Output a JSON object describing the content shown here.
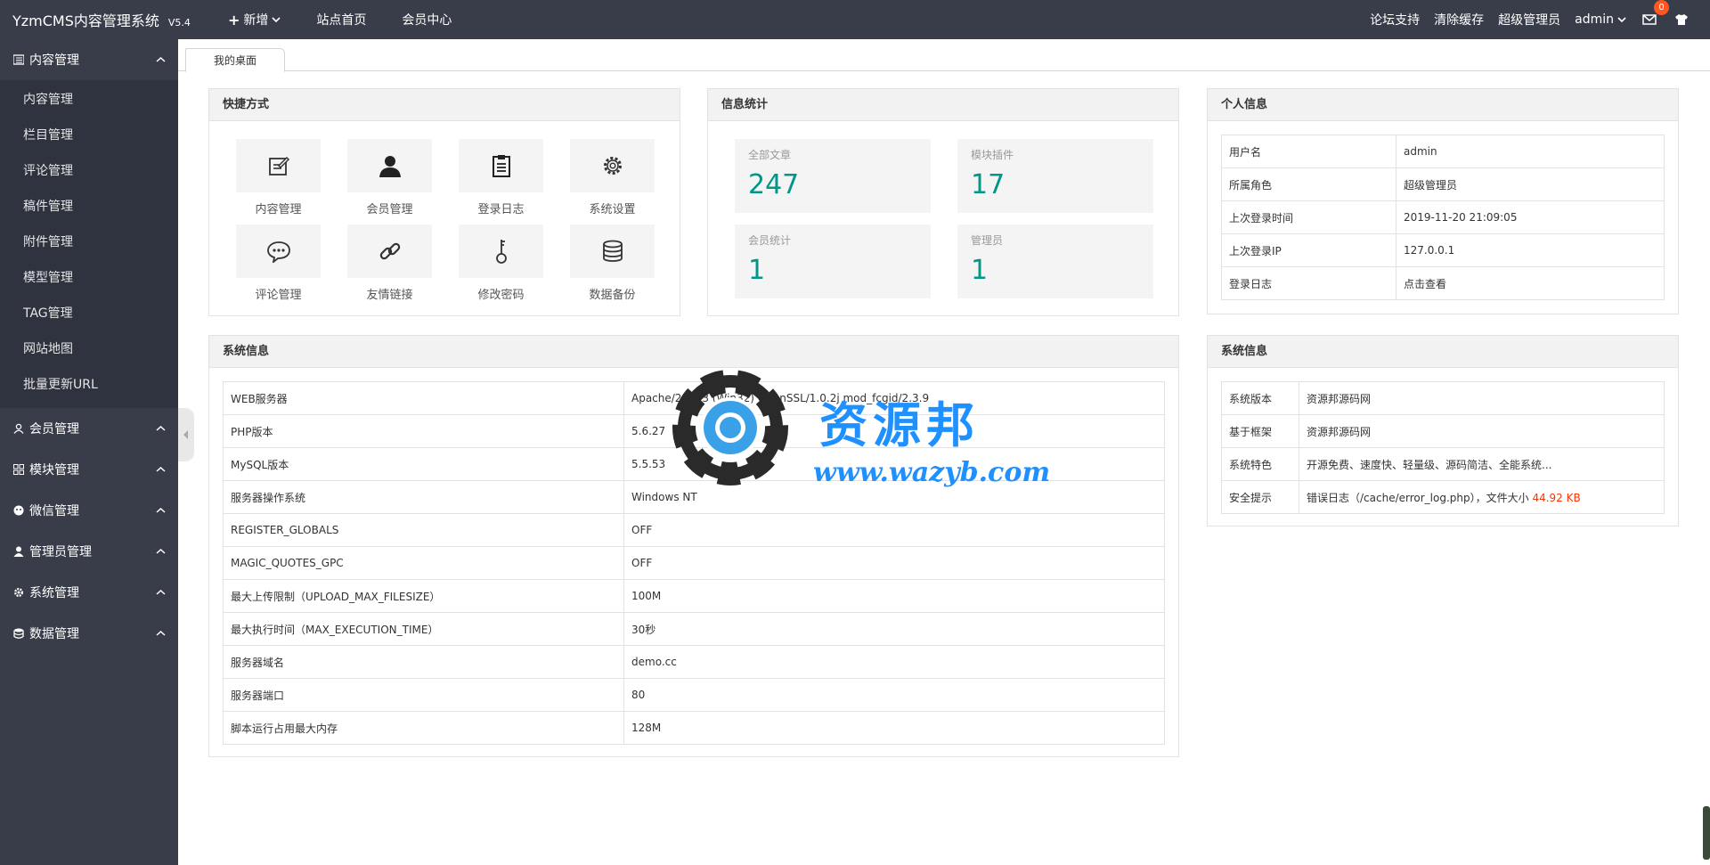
{
  "topbar": {
    "brand": "YzmCMS内容管理系统",
    "version": "V5.4",
    "nav": [
      "新增",
      "站点首页",
      "会员中心"
    ],
    "right": {
      "forum": "论坛支持",
      "clear_cache": "清除缓存",
      "role": "超级管理员",
      "user": "admin",
      "mail_count": "0"
    }
  },
  "sidebar": {
    "groups": [
      {
        "label": "内容管理",
        "icon": "list-icon",
        "expanded": true,
        "items": [
          "内容管理",
          "栏目管理",
          "评论管理",
          "稿件管理",
          "附件管理",
          "模型管理",
          "TAG管理",
          "网站地图",
          "批量更新URL"
        ]
      },
      {
        "label": "会员管理",
        "icon": "user-icon"
      },
      {
        "label": "模块管理",
        "icon": "grid-icon"
      },
      {
        "label": "微信管理",
        "icon": "wechat-icon"
      },
      {
        "label": "管理员管理",
        "icon": "admin-icon"
      },
      {
        "label": "系统管理",
        "icon": "gear-icon"
      },
      {
        "label": "数据管理",
        "icon": "database-icon"
      }
    ]
  },
  "tabs": {
    "active": "我的桌面"
  },
  "shortcuts": {
    "title": "快捷方式",
    "items": [
      {
        "label": "内容管理",
        "icon": "edit-icon"
      },
      {
        "label": "会员管理",
        "icon": "user-icon"
      },
      {
        "label": "登录日志",
        "icon": "clipboard-icon"
      },
      {
        "label": "系统设置",
        "icon": "gear-icon"
      },
      {
        "label": "评论管理",
        "icon": "comment-icon"
      },
      {
        "label": "友情链接",
        "icon": "link-icon"
      },
      {
        "label": "修改密码",
        "icon": "key-icon"
      },
      {
        "label": "数据备份",
        "icon": "database-icon"
      }
    ]
  },
  "stats": {
    "title": "信息统计",
    "items": [
      {
        "label": "全部文章",
        "value": "247"
      },
      {
        "label": "模块插件",
        "value": "17"
      },
      {
        "label": "会员统计",
        "value": "1"
      },
      {
        "label": "管理员",
        "value": "1"
      }
    ]
  },
  "profile": {
    "title": "个人信息",
    "rows": [
      {
        "k": "用户名",
        "v": "admin"
      },
      {
        "k": "所属角色",
        "v": "超级管理员"
      },
      {
        "k": "上次登录时间",
        "v": "2019-11-20 21:09:05"
      },
      {
        "k": "上次登录IP",
        "v": "127.0.0.1"
      },
      {
        "k": "登录日志",
        "v": "点击查看"
      }
    ]
  },
  "sysinfo": {
    "title": "系统信息",
    "rows": [
      {
        "k": "WEB服务器",
        "v": "Apache/2.4.23 (Win32) OpenSSL/1.0.2j mod_fcgid/2.3.9"
      },
      {
        "k": "PHP版本",
        "v": "5.6.27"
      },
      {
        "k": "MySQL版本",
        "v": "5.5.53"
      },
      {
        "k": "服务器操作系统",
        "v": "Windows NT"
      },
      {
        "k": "REGISTER_GLOBALS",
        "v": "OFF"
      },
      {
        "k": "MAGIC_QUOTES_GPC",
        "v": "OFF"
      },
      {
        "k": "最大上传限制（UPLOAD_MAX_FILESIZE）",
        "v": "100M"
      },
      {
        "k": "最大执行时间（MAX_EXECUTION_TIME）",
        "v": "30秒"
      },
      {
        "k": "服务器域名",
        "v": "demo.cc"
      },
      {
        "k": "服务器端口",
        "v": "80"
      },
      {
        "k": "脚本运行占用最大内存",
        "v": "128M"
      }
    ]
  },
  "sysinfo2": {
    "title": "系统信息",
    "rows": [
      {
        "k": "系统版本",
        "v": "资源邦源码网"
      },
      {
        "k": "基于框架",
        "v": "资源邦源码网"
      },
      {
        "k": "系统特色",
        "v": "开源免费、速度快、轻量级、源码简洁、全能系统..."
      },
      {
        "k": "安全提示",
        "v": "错误日志（/cache/error_log.php），文件大小 ",
        "v_red": "44.92 KB"
      }
    ]
  },
  "watermark": {
    "text": "资源邦",
    "url": "www.wazyb.com"
  },
  "colors": {
    "topbar": "#393d49",
    "accent": "#009688",
    "warning": "#ff3300",
    "watermark": "#1e90ff"
  }
}
